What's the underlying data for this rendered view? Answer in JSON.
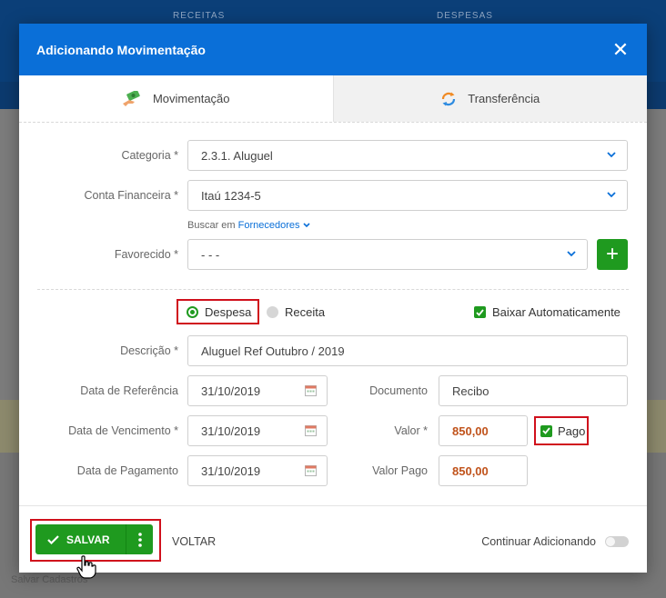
{
  "background": {
    "tab_receitas": "RECEITAS",
    "tab_despesas": "DESPESAS",
    "footer_text": "Salvar Cadastros"
  },
  "modal": {
    "title": "Adicionando Movimentação",
    "close_icon": "close-icon"
  },
  "tabs": [
    {
      "label": "Movimentação",
      "icon": "money-hand-icon",
      "active": true
    },
    {
      "label": "Transferência",
      "icon": "transfer-arrows-icon",
      "active": false
    }
  ],
  "form": {
    "categoria": {
      "label": "Categoria *",
      "value": "2.3.1. Aluguel"
    },
    "conta": {
      "label": "Conta Financeira *",
      "value": "Itaú 1234-5"
    },
    "buscar": {
      "prefix": "Buscar em",
      "link": "Fornecedores"
    },
    "favorecido": {
      "label": "Favorecido *",
      "value": "- - -"
    },
    "tipo": {
      "despesa": "Despesa",
      "receita": "Receita",
      "selected": "Despesa"
    },
    "baixar": {
      "label": "Baixar Automaticamente",
      "checked": true
    },
    "descricao": {
      "label": "Descrição *",
      "value": "Aluguel Ref Outubro / 2019"
    },
    "data_referencia": {
      "label": "Data de Referência",
      "value": "31/10/2019"
    },
    "documento": {
      "label": "Documento",
      "value": "Recibo"
    },
    "data_vencimento": {
      "label": "Data de Vencimento *",
      "value": "31/10/2019"
    },
    "valor": {
      "label": "Valor *",
      "value": "850,00"
    },
    "pago": {
      "label": "Pago",
      "checked": true
    },
    "data_pagamento": {
      "label": "Data de Pagamento",
      "value": "31/10/2019"
    },
    "valor_pago": {
      "label": "Valor Pago",
      "value": "850,00"
    }
  },
  "footer": {
    "save_label": "SALVAR",
    "back_label": "VOLTAR",
    "continue_label": "Continuar Adicionando",
    "continue_on": false
  },
  "colors": {
    "header": "#0a6fd8",
    "primary_green": "#1f9a1f",
    "highlight_red": "#d0101c",
    "money": "#c0521a"
  }
}
